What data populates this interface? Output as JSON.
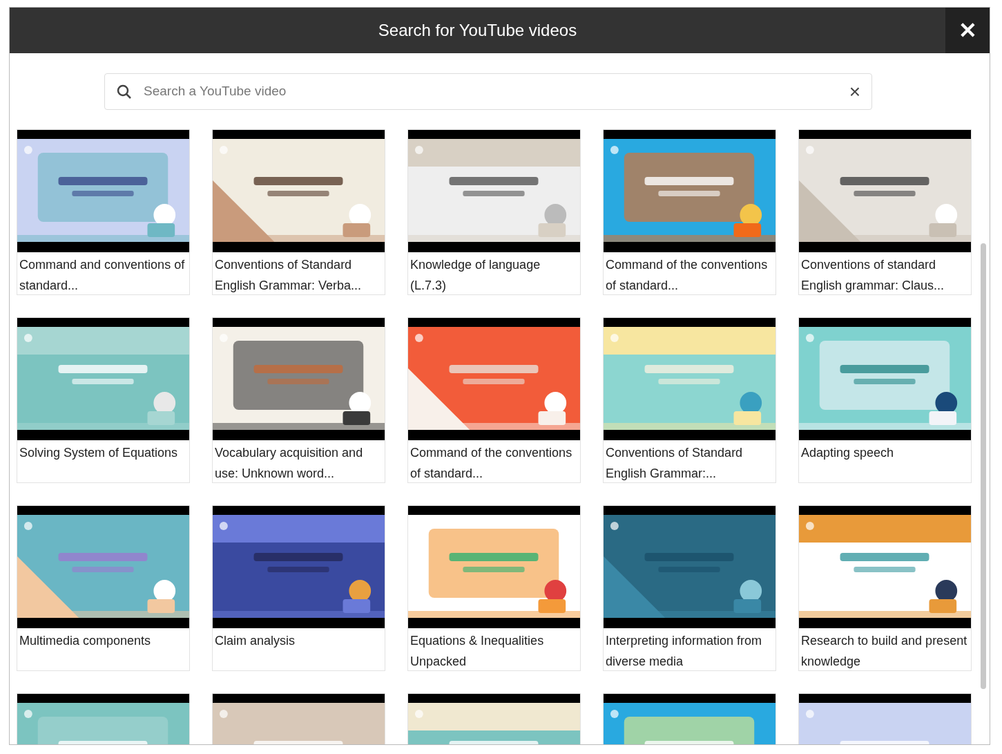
{
  "dialog": {
    "title": "Search for YouTube videos",
    "close": "✕"
  },
  "search": {
    "placeholder": "Search a YouTube video",
    "clear": "×"
  },
  "videos": [
    {
      "title": "Command and conventions of standard...",
      "thumbnail": {
        "kind": "picture"
      }
    },
    {
      "title": "Conventions of Standard English Grammar: Verba...",
      "thumbnail": {
        "kind": "picture"
      }
    },
    {
      "title": "Knowledge of language (L.7.3)",
      "thumbnail": {
        "kind": "picture"
      }
    },
    {
      "title": "Command of the conventions of standard...",
      "thumbnail": {
        "kind": "picture"
      }
    },
    {
      "title": "Conventions of standard English grammar: Claus...",
      "thumbnail": {
        "kind": "picture"
      }
    },
    {
      "title": "Solving System of Equations",
      "thumbnail": {
        "kind": "picture"
      }
    },
    {
      "title": "Vocabulary acquisition and use: Unknown word...",
      "thumbnail": {
        "kind": "picture"
      }
    },
    {
      "title": "Command of the conventions of standard...",
      "thumbnail": {
        "kind": "picture"
      }
    },
    {
      "title": "Conventions of Standard English Grammar:...",
      "thumbnail": {
        "kind": "picture"
      }
    },
    {
      "title": "Adapting speech",
      "thumbnail": {
        "kind": "picture"
      }
    },
    {
      "title": "Multimedia components",
      "thumbnail": {
        "kind": "picture"
      }
    },
    {
      "title": "Claim analysis",
      "thumbnail": {
        "kind": "picture"
      }
    },
    {
      "title": "Equations & Inequalities Unpacked",
      "thumbnail": {
        "kind": "picture"
      }
    },
    {
      "title": "Interpreting information from diverse media",
      "thumbnail": {
        "kind": "picture"
      }
    },
    {
      "title": "Research to build and present knowledge",
      "thumbnail": {
        "kind": "picture"
      }
    },
    {
      "thumbnail": {
        "kind": "picture"
      }
    },
    {
      "thumbnail": {
        "kind": "picture"
      }
    },
    {
      "thumbnail": {
        "kind": "picture"
      }
    },
    {
      "thumbnail": {
        "kind": "picture"
      }
    },
    {
      "thumbnail": {
        "kind": "picture"
      }
    }
  ]
}
